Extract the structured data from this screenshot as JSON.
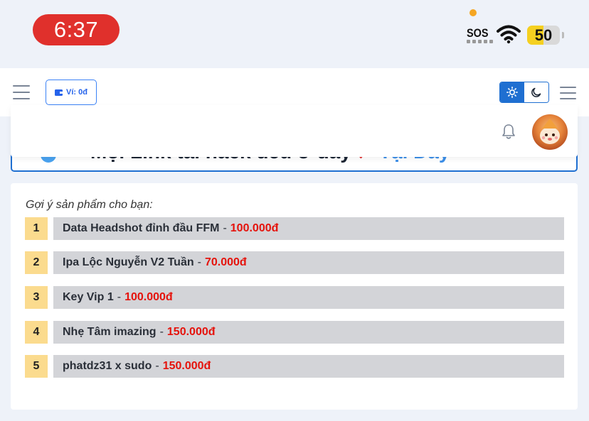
{
  "status_bar": {
    "time": "6:37",
    "sos": "SOS",
    "battery": "50",
    "battery_level": 0.5
  },
  "navbar": {
    "wallet_label": "Ví: 0đ"
  },
  "banner": {
    "text": "Mọi Link tải hack đều ở đây",
    "arrow": "➚",
    "link": "Tại Đây"
  },
  "products": {
    "title": "Gợi ý sản phẩm cho bạn:",
    "items": [
      {
        "rank": "1",
        "name": "Data Headshot đỉnh đầu FFM",
        "price": "100.000đ"
      },
      {
        "rank": "2",
        "name": "Ipa Lộc Nguyễn V2 Tuần",
        "price": "70.000đ"
      },
      {
        "rank": "3",
        "name": "Key Vip 1",
        "price": "100.000đ"
      },
      {
        "rank": "4",
        "name": "Nhẹ Tâm imazing",
        "price": "150.000đ"
      },
      {
        "rank": "5",
        "name": "phatdz31 x sudo",
        "price": "150.000đ"
      }
    ]
  },
  "colors": {
    "accent": "#1f6fd1",
    "price": "#e5130c",
    "rank_bg": "#fbdb8e",
    "time_pill": "#e0302c"
  }
}
